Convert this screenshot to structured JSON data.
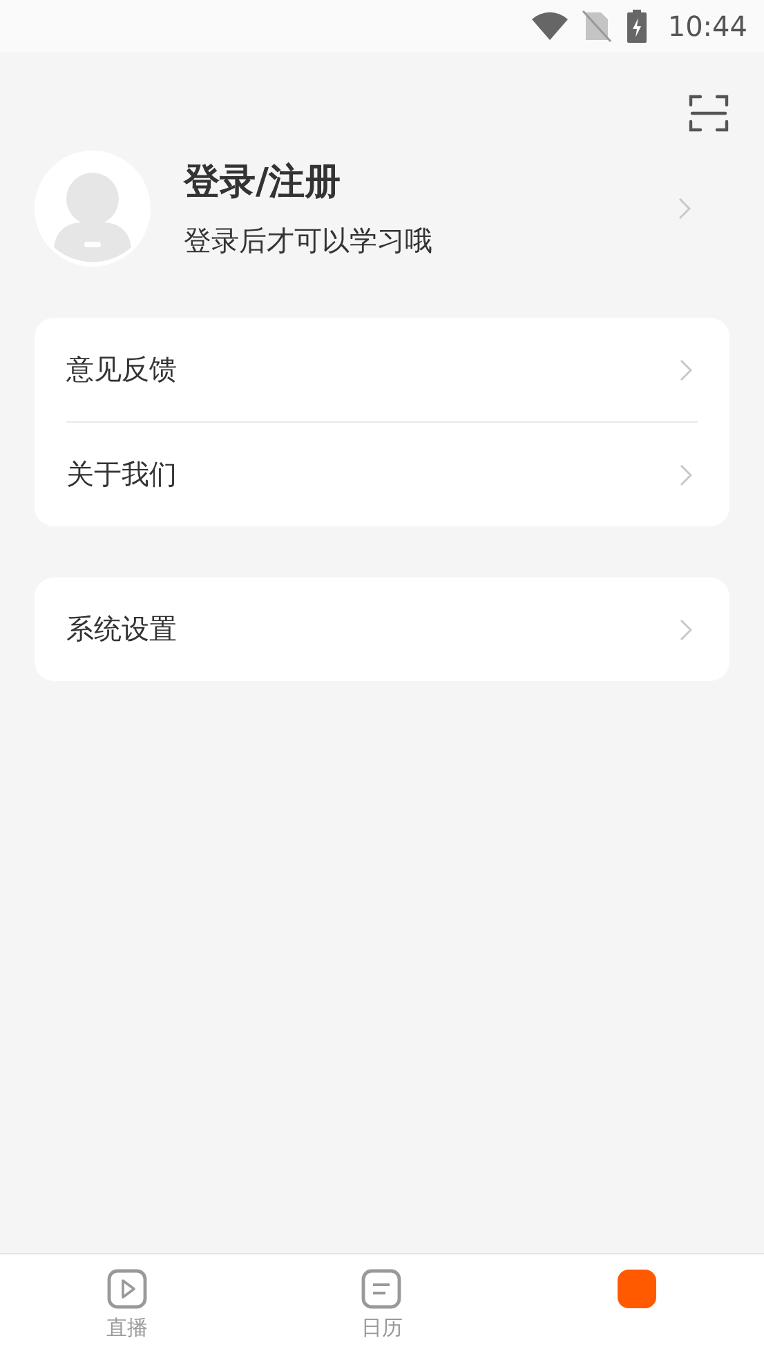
{
  "status_bar": {
    "time": "10:44"
  },
  "profile": {
    "title": "登录/注册",
    "subtitle": "登录后才可以学习哦"
  },
  "menu_groups": [
    {
      "items": [
        {
          "label": "意见反馈"
        },
        {
          "label": "关于我们"
        }
      ]
    },
    {
      "items": [
        {
          "label": "系统设置"
        }
      ]
    }
  ],
  "tab_bar": [
    {
      "label": "直播",
      "kind": "play",
      "selected": false
    },
    {
      "label": "日历",
      "kind": "calendar",
      "selected": false
    },
    {
      "kind": "profile",
      "selected": true
    }
  ]
}
